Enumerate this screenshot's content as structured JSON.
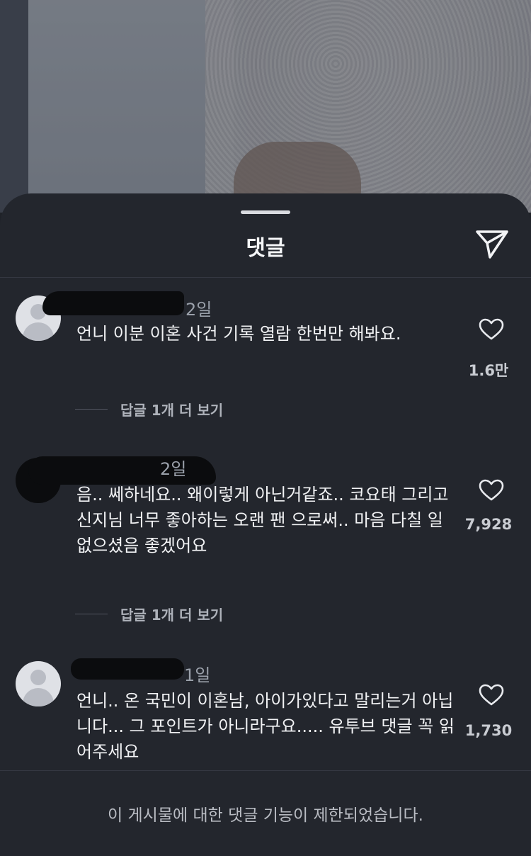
{
  "sheet": {
    "title": "댓글",
    "icons": {
      "send": "send-icon",
      "heart": "heart-outline-icon",
      "avatar": "default-avatar-icon"
    }
  },
  "comments": [
    {
      "time": "2일",
      "text": "언니 이분 이혼 사건 기록 열람 한번만 해봐요.",
      "likes": "1.6만",
      "replies": "답글 1개 더 보기"
    },
    {
      "time": "2일",
      "text": "음.. 쎄하네요.. 왜이렇게 아닌거같죠.. 코요태 그리고 신지님 너무 좋아하는 오랜 팬 으로써.. 마음 다칠 일 없으셨음 좋겠어요",
      "likes": "7,928",
      "replies": "답글 1개 더 보기"
    },
    {
      "time": "1일",
      "text": "언니.. 온 국민이 이혼남, 아이가있다고 말리는거 아닙니다... 그 포인트가 아니라구요..... 유투브 댓글 꼭 읽어주세요",
      "likes": "1,730"
    }
  ],
  "footer": {
    "notice": "이 게시물에 대한 댓글 기능이 제한되었습니다."
  },
  "colors": {
    "sheet_bg": "#23262d",
    "text": "#f1f2f4",
    "muted": "#9aa0aa"
  }
}
